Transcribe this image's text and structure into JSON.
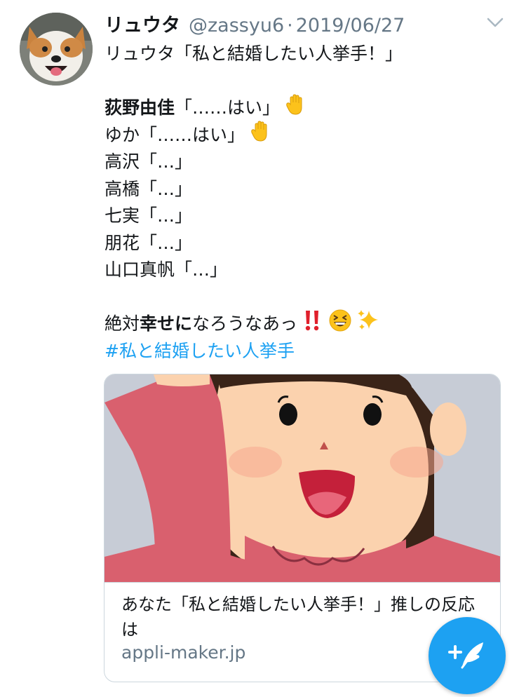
{
  "tweet": {
    "display_name": "リュウタ",
    "handle": "@zassyu6",
    "separator": "·",
    "date": "2019/06/27",
    "line1": "リュウタ「私と結婚したい人挙手！」",
    "line2_bold": "荻野由佳",
    "line2_rest": "「……はい」",
    "line3": "ゆか「……はい」",
    "line4": "高沢「…」",
    "line5": "高橋「…」",
    "line6": "七実「…」",
    "line7": "朋花「…」",
    "line8": "山口真帆「…」",
    "line9_a": "絶対",
    "line9_b_bold": "幸せに",
    "line9_c": "なろうなあっ",
    "hashtag": "#私と結婚したい人挙手"
  },
  "icons": {
    "caret": "chevron-down-icon",
    "raised_hand": "raised-hand-emoji",
    "double_exclamation": "double-exclamation-emoji",
    "grinning_squinting": "grinning-squinting-face-emoji",
    "sparkles": "sparkles-emoji",
    "compose": "compose-tweet-icon"
  },
  "card": {
    "title": "あなた「私と結婚したい人挙手！」推しの反応は",
    "domain": "appli-maker.jp"
  },
  "colors": {
    "accent": "#1da1f2",
    "text": "#14171a",
    "secondary": "#657786",
    "border": "#ccd6dd"
  }
}
